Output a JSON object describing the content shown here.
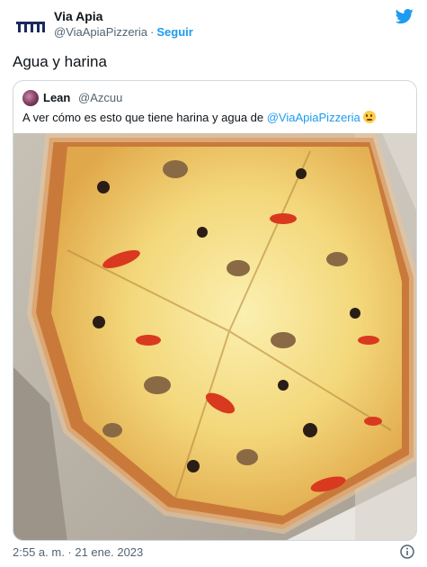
{
  "author": {
    "display_name": "Via Apia",
    "handle": "@ViaApiaPizzeria",
    "separator": "·",
    "follow_label": "Seguir",
    "avatar_icon": "via-apia-logo-icon"
  },
  "tweet": {
    "text": "Agua y harina",
    "timestamp": "2:55 a. m. · 21 ene. 2023"
  },
  "quoted": {
    "display_name": "Lean",
    "handle": "@Azcuu",
    "text_before": "A ver cómo es esto que tiene harina y agua de ",
    "mention": "@ViaApiaPizzeria",
    "emoji": "thinking-face-icon",
    "photo_subject": "pizza-photo"
  },
  "colors": {
    "accent": "#1d9bf0",
    "text": "#0f1419",
    "secondary": "#536471",
    "border": "#cfd9de"
  }
}
